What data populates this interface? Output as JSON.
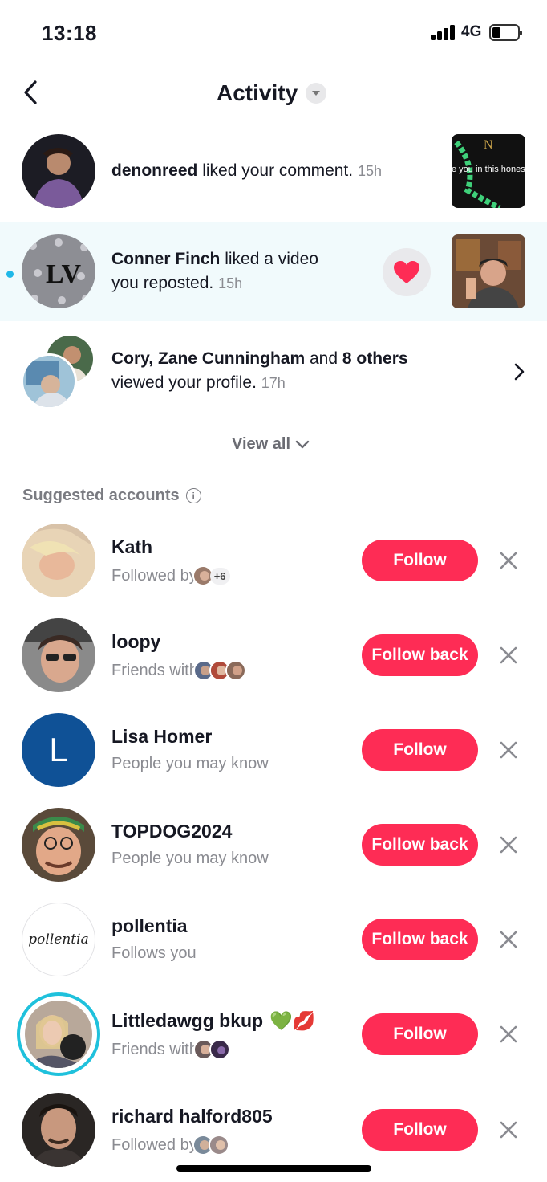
{
  "status_bar": {
    "time": "13:18",
    "network": "4G"
  },
  "header": {
    "title": "Activity"
  },
  "activity": [
    {
      "user": "denonreed",
      "text": "liked your comment.",
      "time": "15h",
      "thumb_caption": "e you in this hones"
    },
    {
      "user": "Conner Finch",
      "text_line1": "liked a video",
      "text_line2": "you reposted.",
      "time": "15h",
      "unread": true
    },
    {
      "users": "Cory, Zane Cunningham",
      "joiner": "and",
      "others": "8 others",
      "text": "viewed your profile.",
      "time": "17h"
    }
  ],
  "view_all": "View all",
  "suggested": {
    "title": "Suggested accounts",
    "accounts": [
      {
        "name": "Kath",
        "sub": "Followed by",
        "plus": "+6",
        "button": "Follow"
      },
      {
        "name": "loopy",
        "sub": "Friends with",
        "button": "Follow back"
      },
      {
        "name": "Lisa Homer",
        "sub": "People you may know",
        "button": "Follow",
        "initial": "L"
      },
      {
        "name": "TOPDOG2024",
        "sub": "People you may know",
        "button": "Follow back"
      },
      {
        "name": "pollentia",
        "sub": "Follows you",
        "button": "Follow back",
        "logo_text": "pollentia"
      },
      {
        "name": "Littledawgg bkup",
        "sub": "Friends with",
        "button": "Follow",
        "emoji": "💚💋"
      },
      {
        "name": "richard halford805",
        "sub": "Followed by",
        "button": "Follow"
      }
    ]
  },
  "colors": {
    "accent": "#fe2c55",
    "highlight_row": "#f1fafc",
    "unread_dot": "#20b8e8",
    "story_ring": "#1fc1dc"
  }
}
